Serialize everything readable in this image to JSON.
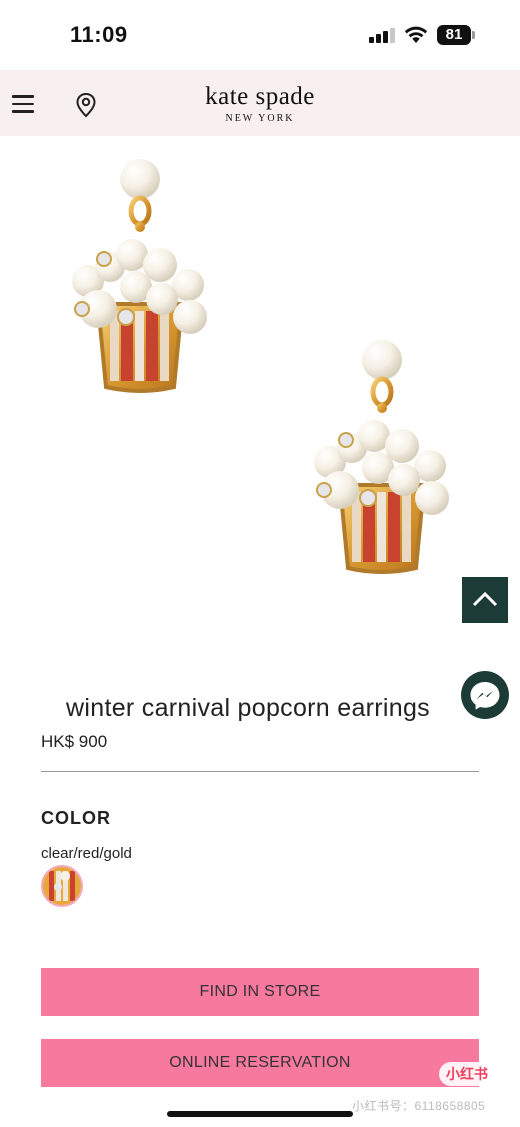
{
  "status_bar": {
    "time": "11:09",
    "battery": "81",
    "signal_bars_active": 3,
    "signal_bars_total": 4
  },
  "header": {
    "brand_name": "kate spade",
    "brand_sub": "NEW YORK",
    "menu_icon": "hamburger-menu-icon",
    "location_icon": "map-pin-icon",
    "background_color": "#f8eff0"
  },
  "product": {
    "title": "winter carnival popcorn earrings",
    "price": "HK$ 900",
    "color_heading": "COLOR",
    "color_value": "clear/red/gold",
    "image_description_icon": "popcorn-earrings-image"
  },
  "actions": {
    "find_in_store": "FIND IN STORE",
    "online_reservation": "ONLINE RESERVATION",
    "button_color": "#f7799e"
  },
  "floating": {
    "scroll_top_icon": "chevron-up-icon",
    "messenger_icon": "messenger-icon",
    "color": "#1d3b36"
  },
  "watermark": {
    "badge": "小红书",
    "text": "小红书号：6118658805"
  }
}
